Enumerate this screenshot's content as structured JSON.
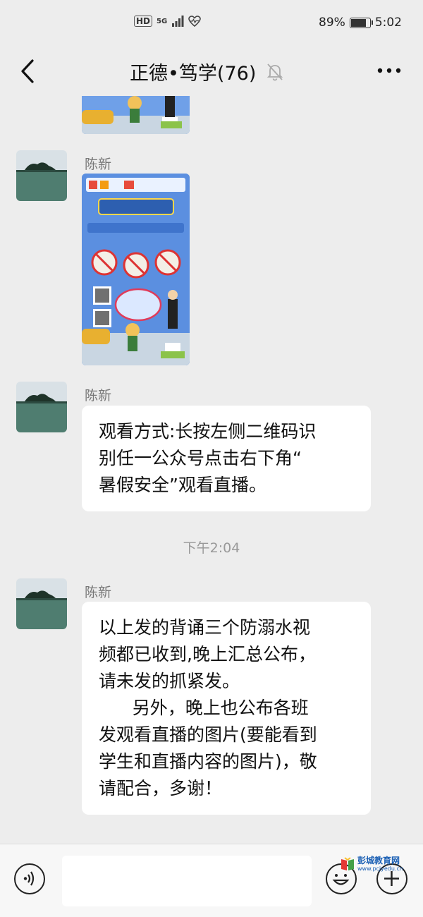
{
  "status_bar": {
    "hd": "HD",
    "network": "5G",
    "battery_percent_text": "89%",
    "battery_level": 0.89,
    "time": "5:02"
  },
  "header": {
    "title": "正德•笃学(76)",
    "back_icon": "chevron-left-icon",
    "mute_icon": "bell-off-icon",
    "more_icon": "more-horizontal-icon"
  },
  "messages": [
    {
      "type": "image",
      "sender": "",
      "note": "poster-top-cropped"
    },
    {
      "type": "image",
      "sender": "陈新"
    },
    {
      "type": "text",
      "sender": "陈新",
      "text": "观看方式:长按左侧二维码识\n别任一公众号点击右下角“\n暑假安全”观看直播。"
    },
    {
      "type": "time",
      "text": "下午2:04"
    },
    {
      "type": "text",
      "sender": "陈新",
      "text": "以上发的背诵三个防溺水视\n频都已收到,晚上汇总公布，\n请未发的抓紧发。\n      另外，晚上也公布各班\n发观看直播的图片(要能看到\n学生和直播内容的图片)，敬\n请配合，多谢！"
    }
  ],
  "input_bar": {
    "voice_icon": "voice-icon",
    "input_value": "",
    "emoji_icon": "emoji-icon",
    "plus_icon": "plus-icon"
  },
  "watermark": {
    "name": "彭城教育网",
    "url": "www.pcjyedu.cn"
  },
  "colors": {
    "background": "#ededed",
    "bubble": "#ffffff",
    "poster_blue": "#5b8fe0"
  }
}
